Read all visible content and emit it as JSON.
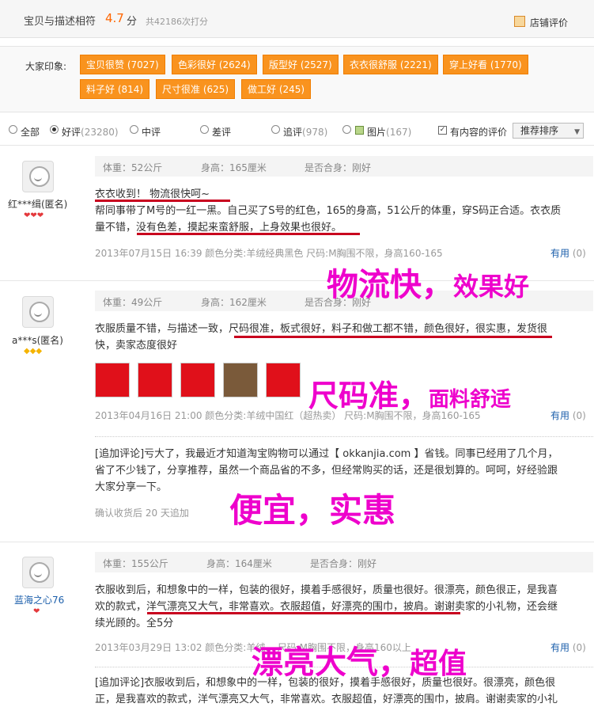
{
  "header": {
    "title": "宝贝与描述相符",
    "score": "4.7",
    "score_unit": "分",
    "count": "共42186次打分",
    "shop_link": "店铺评价"
  },
  "impressions": {
    "label": "大家印象:",
    "tags": [
      "宝贝很赞 (7027)",
      "色彩很好 (2624)",
      "版型好 (2527)",
      "衣衣很舒服 (2221)",
      "穿上好看 (1770)",
      "料子好 (814)",
      "尺寸很准 (625)",
      "做工好 (245)"
    ]
  },
  "filters": {
    "all": "全部",
    "good": "好评",
    "good_count": "(23280)",
    "mid": "中评",
    "bad": "差评",
    "append": "追评",
    "append_count": "(978)",
    "pic": "图片",
    "pic_count": "(167)",
    "has_content": "有内容的评价",
    "sort": "推荐排序",
    "sort_icon": "chevron-down-icon"
  },
  "reviews": [
    {
      "user": "红***缉(匿名)",
      "rank": "❤❤❤",
      "rank_color": "#e4393c",
      "weight": "体重：52公斤",
      "height": "身高：165厘米",
      "fit": "是否合身：刚好",
      "text": [
        "衣衣收到！ 物流很快呵~",
        "帮同事带了M号的一红一黑。自己买了S号的红色，165的身高，51公斤的体重，穿S码正合适。衣衣质",
        "量不错，没有色差，摸起来蛮舒服，上身效果也很好。"
      ],
      "meta": "2013年07月15日 16:39    颜色分类:羊绒经典黑色    尺码:M胸围不限，身高160-165",
      "useful": "有用",
      "useful_count": "(0)"
    },
    {
      "user": "a***s(匿名)",
      "rank": "◆◆◆",
      "rank_color": "#f5b400",
      "weight": "体重：49公斤",
      "height": "身高：162厘米",
      "fit": "是否合身：刚好",
      "text": [
        "衣服质量不错，与描述一致，尺码很准，板式很好，料子和做工都不错，颜色很好，很实惠，发货很",
        "快，卖家态度很好"
      ],
      "meta": "2013年04月16日 21:00    颜色分类:羊绒中国红（超热卖）    尺码:M胸围不限，身高160-165",
      "useful": "有用",
      "useful_count": "(0)",
      "followup": [
        "[追加评论]亏大了，我最近才知道淘宝购物可以通过【 okkanjia.com 】省钱。同事已经用了几个月，",
        "省了不少钱了，分享推荐，虽然一个商品省的不多，但经常购买的话，还是很划算的。呵呵，好经验跟",
        "大家分享一下。"
      ],
      "followup_meta": "确认收货后 20 天追加"
    },
    {
      "user": "蓝海之心76",
      "rank": "❤",
      "rank_color": "#e4393c",
      "weight": "体重：155公斤",
      "height": "身高：164厘米",
      "fit": "是否合身：刚好",
      "text": [
        "衣服收到后，和想象中的一样，包装的很好，摸着手感很好，质量也很好。很漂亮，颜色很正，是我喜",
        "欢的款式，洋气漂亮又大气，非常喜欢。衣服超值，好漂亮的围巾，披肩。谢谢卖家的小礼物，还会继",
        "续光顾的。全5分"
      ],
      "meta": "2013年03月29日 13:02    颜色分类:羊绒...    尺码:M胸围不限，身高160以上",
      "useful": "有用",
      "useful_count": "(0)",
      "followup": [
        "[追加评论]衣服收到后，和想象中的一样，包装的很好，摸着手感很好，质量也很好。很漂亮，颜色很",
        "正，是我喜欢的款式，洋气漂亮又大气，非常喜欢。衣服超值，好漂亮的围巾，披肩。谢谢卖家的小礼"
      ]
    }
  ],
  "overlays": {
    "o1a": "物流快，",
    "o1b": "效果好",
    "o2a": "尺码准，",
    "o2b": "面料舒适",
    "o3": "便宜，实惠",
    "o4a": "漂亮大气，",
    "o4b": "超值"
  },
  "colors": {
    "accent": "#f9931e",
    "annotation": "#ee00cc",
    "underline": "#c8001e",
    "link": "#1c5fab"
  }
}
